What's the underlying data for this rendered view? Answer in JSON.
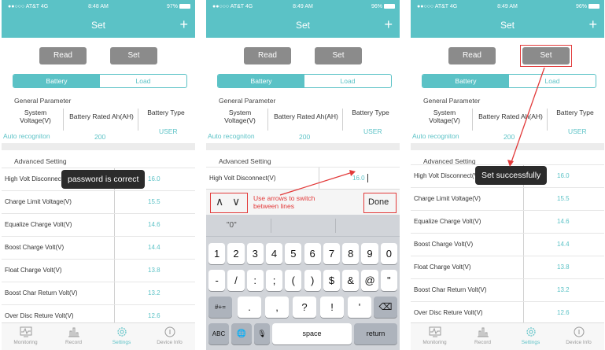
{
  "colors": {
    "accent": "#5bc2c6",
    "annotation": "#e23a3a",
    "toast_bg": "#2b2b2b",
    "button_gray": "#8b8b8b"
  },
  "screens": [
    {
      "status": {
        "carrier": "●●○○○ AT&T  4G",
        "time": "8:48 AM",
        "battery": "97%"
      },
      "nav": {
        "title": "Set",
        "plus": "+"
      },
      "buttons": {
        "read": "Read",
        "set": "Set"
      },
      "segments": {
        "battery": "Battery",
        "load": "Load"
      },
      "general": {
        "title": "General Parameter",
        "system_voltage_label": "System Voltage(V)",
        "rated_label": "Battery Rated Ah(AH)",
        "type_label": "Battery Type",
        "system_voltage_value": "Auto recogniton",
        "rated_value": "200",
        "type_value": "USER"
      },
      "advanced": {
        "title": "Advanced Setting",
        "rows": [
          {
            "label": "High Volt Disconnect(V)",
            "value": "16.0"
          },
          {
            "label": "Charge Limit Voltage(V)",
            "value": "15.5"
          },
          {
            "label": "Equalize Charge Volt(V)",
            "value": "14.6"
          },
          {
            "label": "Boost Charge Volt(V)",
            "value": "14.4"
          },
          {
            "label": "Float Charge Volt(V)",
            "value": "13.8"
          },
          {
            "label": "Boost Char Return Volt(V)",
            "value": "13.2"
          },
          {
            "label": "Over Disc Reture Volt(V)",
            "value": "12.6"
          }
        ]
      },
      "toast": "password is correct",
      "tabs": [
        "Monitoring",
        "Record",
        "Settings",
        "Device Info"
      ]
    },
    {
      "status": {
        "carrier": "●●○○○ AT&T  4G",
        "time": "8:49 AM",
        "battery": "96%"
      },
      "nav": {
        "title": "Set",
        "plus": "+"
      },
      "buttons": {
        "read": "Read",
        "set": "Set"
      },
      "segments": {
        "battery": "Battery",
        "load": "Load"
      },
      "general": {
        "title": "General Parameter",
        "system_voltage_label": "System Voltage(V)",
        "rated_label": "Battery Rated Ah(AH)",
        "type_label": "Battery Type",
        "system_voltage_value": "Auto recogniton",
        "rated_value": "200",
        "type_value": "USER"
      },
      "advanced": {
        "title": "Advanced Setting",
        "rows": [
          {
            "label": "High Volt Disconnect(V)",
            "value": "16.0"
          }
        ]
      },
      "accessory": {
        "up": "∧",
        "down": "∨",
        "hint": "Use arrows to switch between lines",
        "done": "Done"
      },
      "keyboard": {
        "suggestion": "\"0\"",
        "row1": [
          "1",
          "2",
          "3",
          "4",
          "5",
          "6",
          "7",
          "8",
          "9",
          "0"
        ],
        "row2": [
          "-",
          "/",
          ":",
          ";",
          "(",
          ")",
          "$",
          "&",
          "@",
          "\""
        ],
        "row3": [
          ".",
          ",",
          "?",
          "!",
          "'"
        ],
        "shift": "#+=",
        "backspace": "⌫",
        "abc": "ABC",
        "globe": "🌐",
        "mic": "🎙",
        "space": "space",
        "return": "return"
      }
    },
    {
      "status": {
        "carrier": "●●○○○ AT&T  4G",
        "time": "8:49 AM",
        "battery": "96%"
      },
      "nav": {
        "title": "Set",
        "plus": "+"
      },
      "buttons": {
        "read": "Read",
        "set": "Set"
      },
      "segments": {
        "battery": "Battery",
        "load": "Load"
      },
      "general": {
        "title": "General Parameter",
        "system_voltage_label": "System Voltage(V)",
        "rated_label": "Battery Rated Ah(AH)",
        "type_label": "Battery Type",
        "system_voltage_value": "Auto recogniton",
        "rated_value": "200",
        "type_value": "USER"
      },
      "advanced": {
        "title": "Advanced Setting",
        "rows": [
          {
            "label": "High Volt Disconnect(V)",
            "value": "16.0"
          },
          {
            "label": "Charge Limit Voltage(V)",
            "value": "15.5"
          },
          {
            "label": "Equalize Charge Volt(V)",
            "value": "14.6"
          },
          {
            "label": "Boost Charge Volt(V)",
            "value": "14.4"
          },
          {
            "label": "Float Charge Volt(V)",
            "value": "13.8"
          },
          {
            "label": "Boost Char Return Volt(V)",
            "value": "13.2"
          },
          {
            "label": "Over Disc Reture Volt(V)",
            "value": "12.6"
          }
        ]
      },
      "toast": "Set successfully",
      "tabs": [
        "Monitoring",
        "Record",
        "Settings",
        "Device Info"
      ]
    }
  ]
}
